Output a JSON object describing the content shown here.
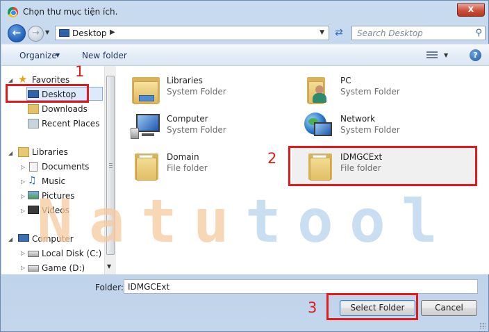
{
  "window": {
    "title": "Chọn thư mục tiện ích.",
    "close_glyph": "x"
  },
  "address_bar": {
    "path": "Desktop",
    "search_placeholder": "Search Desktop"
  },
  "toolbar": {
    "organize_label": "Organize",
    "new_folder_label": "New folder",
    "help_glyph": "?"
  },
  "nav_pane": {
    "favorites": {
      "label": "Favorites",
      "items": [
        "Desktop",
        "Downloads",
        "Recent Places"
      ]
    },
    "libraries": {
      "label": "Libraries",
      "items": [
        "Documents",
        "Music",
        "Pictures",
        "Videos"
      ]
    },
    "computer": {
      "label": "Computer",
      "items": [
        "Local Disk (C:)",
        "Game (D:)"
      ]
    },
    "selected": "Desktop"
  },
  "items": [
    {
      "name": "Libraries",
      "type": "System Folder",
      "icon": "libraries-icon"
    },
    {
      "name": "PC",
      "type": "System Folder",
      "icon": "user-folder-icon"
    },
    {
      "name": "Computer",
      "type": "System Folder",
      "icon": "computer-icon"
    },
    {
      "name": "Network",
      "type": "System Folder",
      "icon": "network-icon"
    },
    {
      "name": "Domain",
      "type": "File folder",
      "icon": "folder-icon"
    },
    {
      "name": "IDMGCExt",
      "type": "File folder",
      "icon": "folder-icon"
    }
  ],
  "footer": {
    "folder_label": "Folder:",
    "folder_value": "IDMGCExt",
    "select_button": "Select Folder",
    "cancel_button": "Cancel"
  },
  "annotations": [
    "1",
    "2",
    "3"
  ],
  "watermark": {
    "text": "Natutool",
    "color_warm": "#f6caa0",
    "color_cool": "#b8d3ec"
  },
  "colors": {
    "annotation_red": "#e01b1b",
    "selection_blue": "#dceafc"
  }
}
